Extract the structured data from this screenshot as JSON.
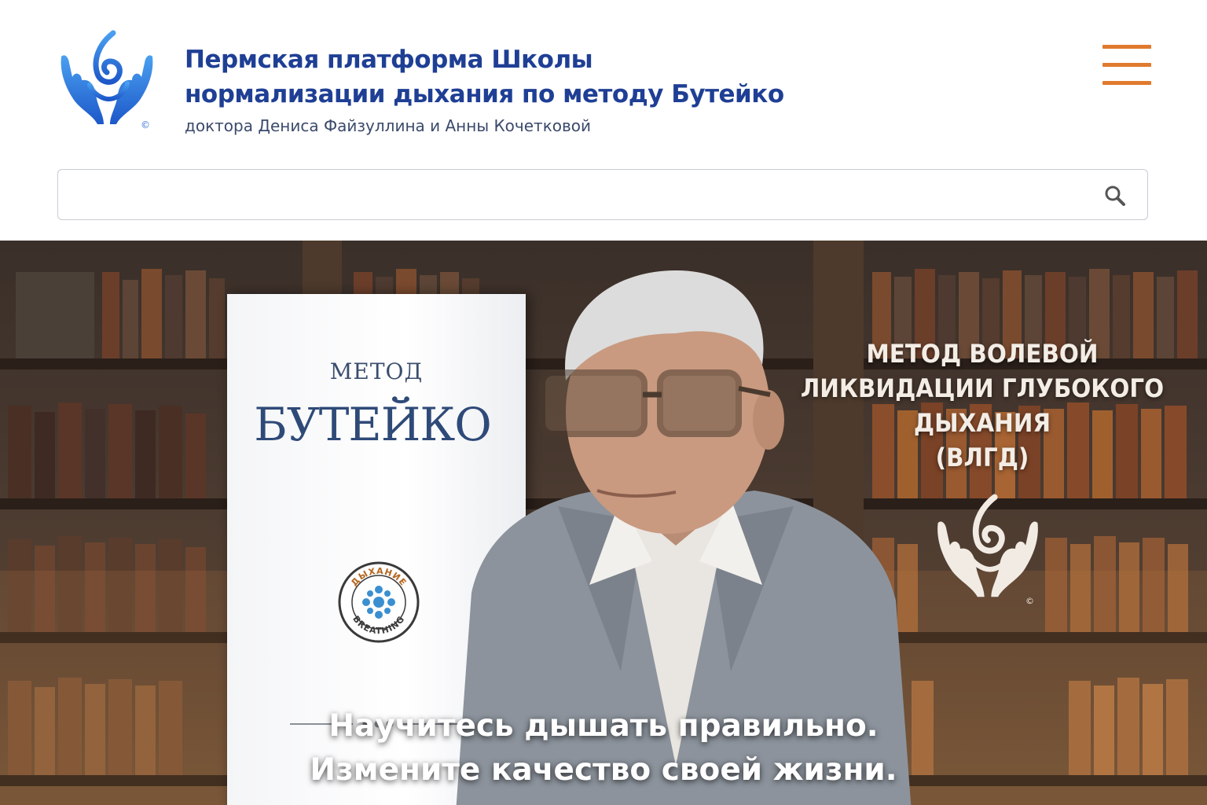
{
  "header": {
    "title_line_1": "Пермская платформа Школы",
    "title_line_2": "нормализации дыхания по методу Бутейко",
    "subtitle": "доктора Дениса Файзуллина и Анны Кочетковой",
    "copyright_mark": "©",
    "logo_icon": "hands-breath-logo-icon",
    "menu_icon": "hamburger-menu-icon"
  },
  "search": {
    "value": "",
    "placeholder": "",
    "icon": "search-icon"
  },
  "hero": {
    "poster": {
      "small_text": "МЕТОД",
      "big_text": "БУТЕЙКО",
      "badge_top": "ДЫХАНИЕ",
      "badge_bottom": "BREATHING"
    },
    "heading_lines": [
      "МЕТОД ВОЛЕВОЙ",
      "ЛИКВИДАЦИИ ГЛУБОКОГО",
      "ДЫХАНИЯ",
      "(ВЛГД)"
    ],
    "copyright_mark": "©",
    "tagline_line_1": "Научитесь дышать правильно.",
    "tagline_line_2": "Измените качество своей жизни."
  },
  "colors": {
    "brand_blue": "#1f3f95",
    "logo_blue": "#2f6fd6",
    "menu_orange": "#e07a2e"
  }
}
